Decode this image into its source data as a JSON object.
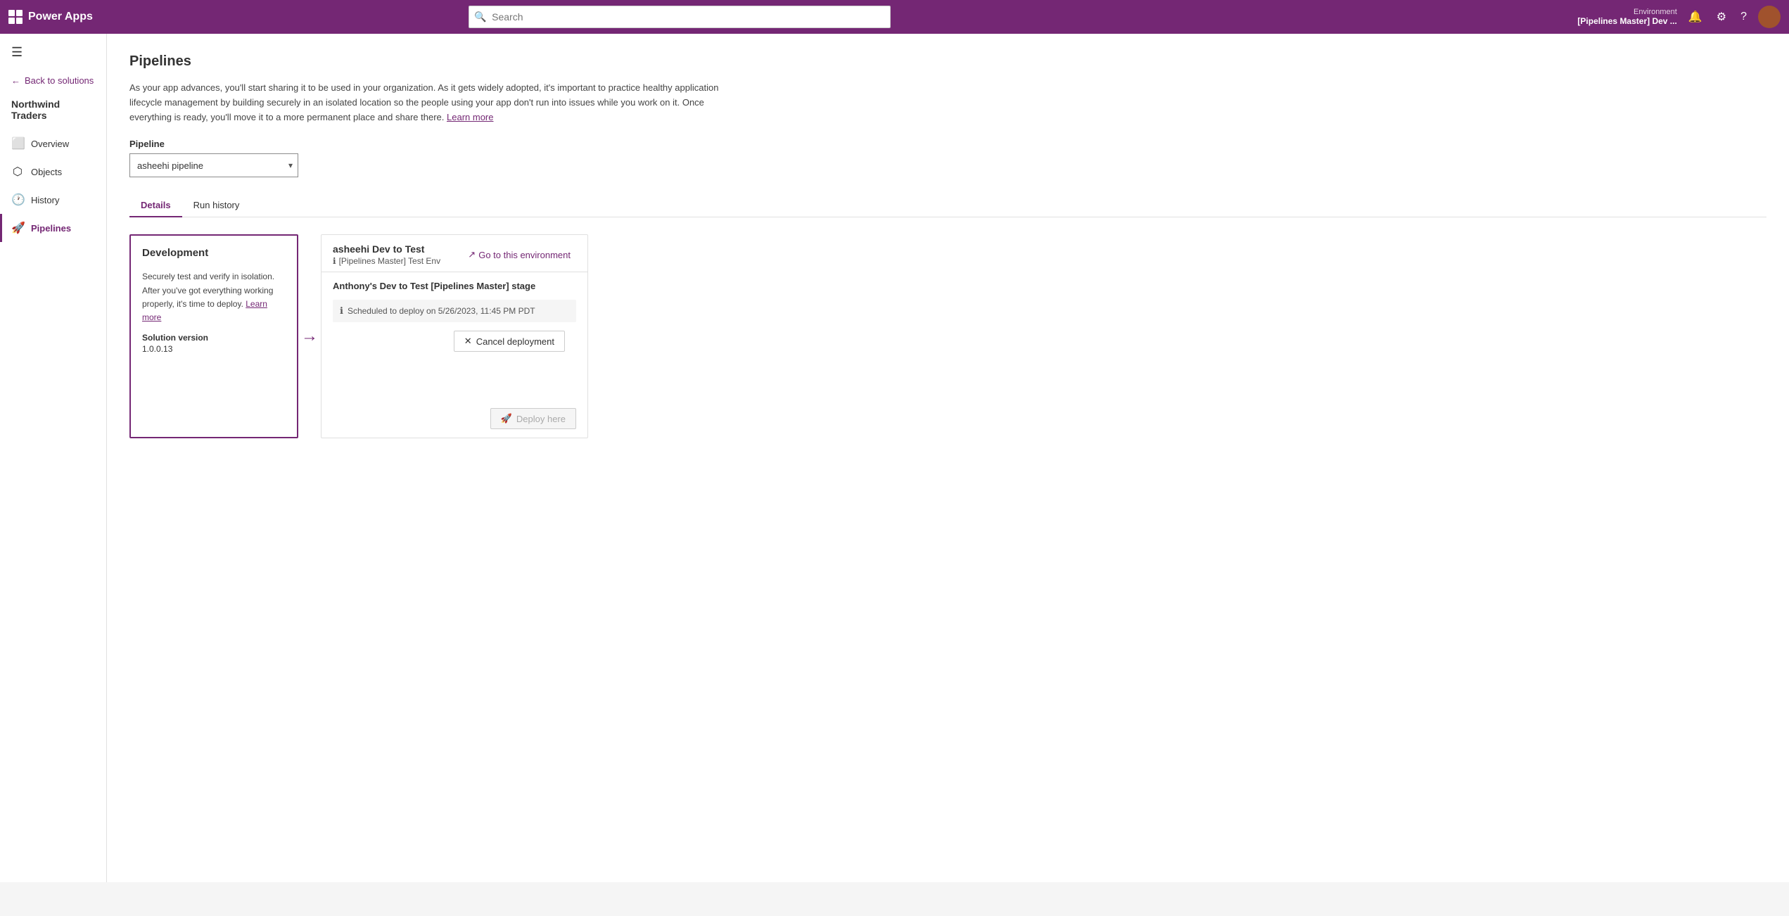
{
  "topnav": {
    "app_name": "Power Apps",
    "search_placeholder": "Search",
    "env_label": "Environment",
    "env_name": "[Pipelines Master] Dev ..."
  },
  "sidebar": {
    "hamburger_label": "☰",
    "back_label": "Back to solutions",
    "app_name": "Northwind Traders",
    "items": [
      {
        "id": "overview",
        "label": "Overview",
        "icon": "⬜"
      },
      {
        "id": "objects",
        "label": "Objects",
        "icon": "⬡"
      },
      {
        "id": "history",
        "label": "History",
        "icon": "🕐"
      },
      {
        "id": "pipelines",
        "label": "Pipelines",
        "icon": "🚀",
        "active": true
      }
    ]
  },
  "main": {
    "page_title": "Pipelines",
    "description": "As your app advances, you'll start sharing it to be used in your organization. As it gets widely adopted, it's important to practice healthy application lifecycle management by building securely in an isolated location so the people using your app don't run into issues while you work on it. Once everything is ready, you'll move it to a more permanent place and share there.",
    "learn_more": "Learn more",
    "pipeline_label": "Pipeline",
    "pipeline_select_value": "asheehi pipeline",
    "tabs": [
      {
        "id": "details",
        "label": "Details",
        "active": true
      },
      {
        "id": "run_history",
        "label": "Run history",
        "active": false
      }
    ],
    "dev_stage": {
      "title": "Development",
      "description": "Securely test and verify in isolation. After you've got everything working properly, it's time to deploy.",
      "learn_more": "Learn more",
      "solution_version_label": "Solution version",
      "solution_version": "1.0.0.13"
    },
    "test_stage": {
      "title": "asheehi Dev to Test",
      "env_name": "[Pipelines Master] Test Env",
      "go_to_env_label": "Go to this environment",
      "stage_label": "Anthony's Dev to Test [Pipelines Master] stage",
      "scheduled_info": "Scheduled to deploy on 5/26/2023, 11:45 PM PDT",
      "cancel_btn_label": "Cancel deployment",
      "deploy_btn_label": "Deploy here"
    }
  }
}
